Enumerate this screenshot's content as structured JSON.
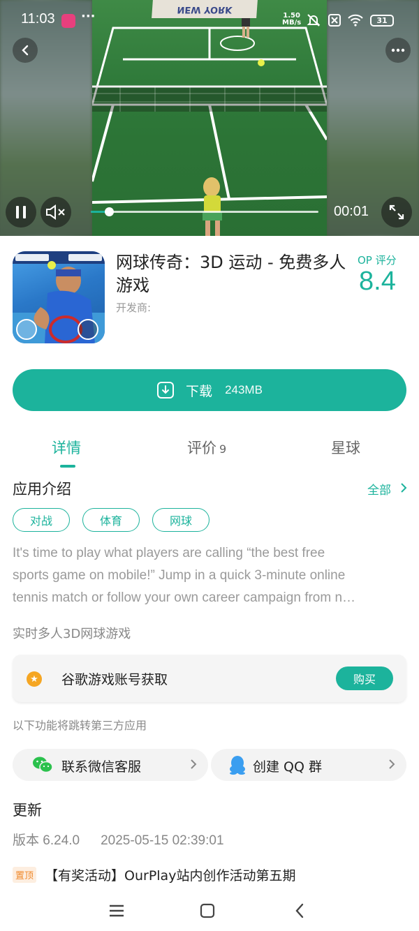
{
  "status_bar": {
    "time": "11:03",
    "dots": "···",
    "net_speed_value": "1.50",
    "net_speed_unit": "MB/s",
    "battery": "31"
  },
  "video": {
    "banner_text": "NEW YORK",
    "current_time": "00:01",
    "progress_fraction": 0.08,
    "muted": true
  },
  "app": {
    "title": "网球传奇：3D 运动 - 免费多人游戏",
    "developer_label": "开发商:",
    "op_label": "OP 评分",
    "op_score": "8.4"
  },
  "download": {
    "label": "下载",
    "size": "243MB"
  },
  "tabs": [
    {
      "label": "详情",
      "active": true
    },
    {
      "label": "评价",
      "count": "9"
    },
    {
      "label": "星球"
    }
  ],
  "intro": {
    "title": "应用介绍",
    "all_label": "全部",
    "tags": [
      "对战",
      "体育",
      "网球"
    ],
    "desc_lines": [
      "It's time to play what players are calling “the best free",
      "sports game on mobile!” Jump in a quick 3-minute online",
      "tennis match or follow your own career campaign from n…"
    ],
    "subtitle": "实时多人3D网球游戏"
  },
  "account_card": {
    "label": "谷歌游戏账号获取",
    "buy_label": "购买"
  },
  "third_party_note": "以下功能将跳转第三方应用",
  "contacts": {
    "wechat_label": "联系微信客服",
    "qq_label": "创建 QQ 群"
  },
  "update": {
    "title": "更新",
    "version": "版本 6.24.0",
    "date": "2025-05-15 02:39:01"
  },
  "news": {
    "badge": "置顶",
    "text": "【有奖活动】OurPlay站内创作活动第五期"
  },
  "colors": {
    "accent": "#1cb39c",
    "pin_badge": "#f08a2d",
    "star_badge": "#f5a623"
  }
}
